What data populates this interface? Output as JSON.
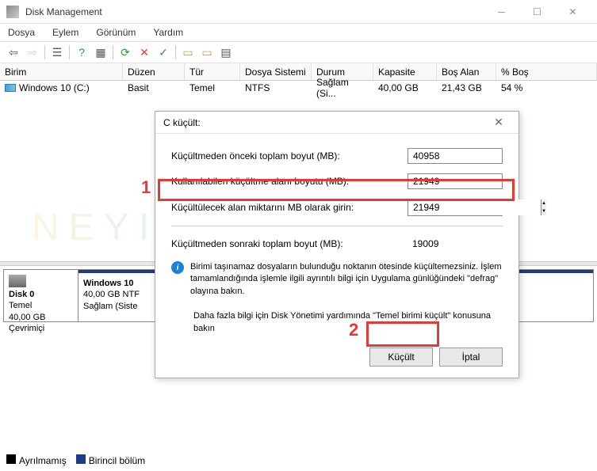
{
  "window": {
    "title": "Disk Management"
  },
  "menu": {
    "file": "Dosya",
    "action": "Eylem",
    "view": "Görünüm",
    "help": "Yardım"
  },
  "columns": {
    "volume": "Birim",
    "layout": "Düzen",
    "type": "Tür",
    "filesystem": "Dosya Sistemi",
    "status": "Durum",
    "capacity": "Kapasite",
    "freespace": "Boş Alan",
    "percentfree": "% Boş"
  },
  "volumes": [
    {
      "name": "Windows 10 (C:)",
      "layout": "Basit",
      "type": "Temel",
      "filesystem": "NTFS",
      "status": "Sağlam (Si...",
      "capacity": "40,00 GB",
      "freespace": "21,43 GB",
      "percentfree": "54 %"
    }
  ],
  "disk": {
    "name": "Disk 0",
    "type": "Temel",
    "size": "40,00 GB",
    "status": "Çevrimiçi",
    "vol_name": "Windows 10",
    "vol_size": "40,00 GB NTF",
    "vol_status": "Sağlam (Siste"
  },
  "legend": {
    "unallocated": "Ayrılmamış",
    "primary": "Birincil bölüm"
  },
  "dialog": {
    "title": "C küçült:",
    "label_before": "Küçültmeden önceki toplam boyut (MB):",
    "value_before": "40958",
    "label_available": "Kullanılabilen küçültme alanı boyutu (MB):",
    "value_available": "21949",
    "label_shrink": "Küçültülecek alan miktarını MB olarak girin:",
    "value_shrink": "21949",
    "label_after": "Küçültmeden sonraki toplam boyut (MB):",
    "value_after": "19009",
    "info_text": "Birimi taşınamaz dosyaların bulunduğu noktanın ötesinde küçültemezsiniz. İşlem tamamlandığında işlemle ilgili ayrıntılı bilgi için Uygulama günlüğündeki \"defrag\" olayına bakın.",
    "help_text": "Daha fazla bilgi için Disk Yönetimi yardımında \"Temel birimi küçült\" konusuna bakın",
    "btn_shrink": "Küçült",
    "btn_cancel": "İptal"
  },
  "annotations": {
    "num1": "1",
    "num2": "2"
  },
  "watermark": "NEYIOLUR.COM"
}
